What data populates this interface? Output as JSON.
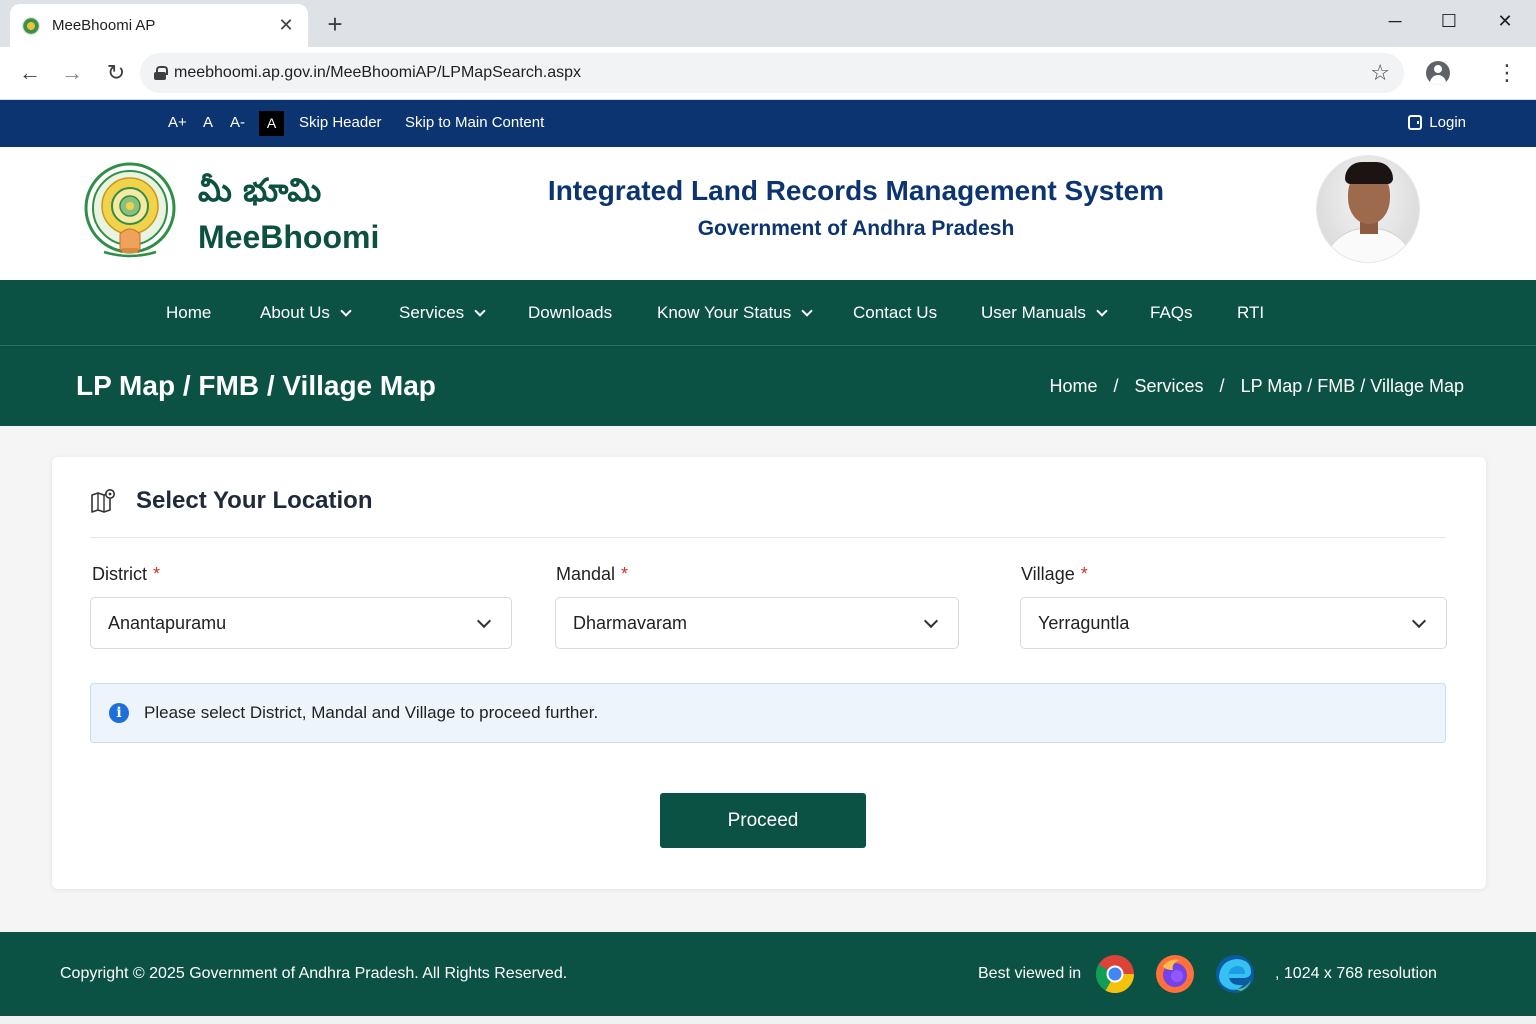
{
  "browser": {
    "tab_title": "MeeBhoomi AP",
    "url": "meebhoomi.ap.gov.in/MeeBhoomiAP/LPMapSearch.aspx"
  },
  "utility": {
    "font_increase": "A+",
    "font_normal": "A",
    "font_decrease": "A-",
    "contrast": "A",
    "skip_header": "Skip Header",
    "skip_main": "Skip to Main Content",
    "login": "Login"
  },
  "header": {
    "brand_telugu": "మీ భూమి",
    "brand_en": "MeeBhoomi",
    "title": "Integrated Land Records Management System",
    "subtitle": "Government of Andhra Pradesh"
  },
  "nav": {
    "items": [
      {
        "label": "Home"
      },
      {
        "label": "About Us"
      },
      {
        "label": "Services"
      },
      {
        "label": "Downloads"
      },
      {
        "label": "Know Your Status"
      },
      {
        "label": "Contact Us"
      },
      {
        "label": "User Manuals"
      },
      {
        "label": "FAQs"
      },
      {
        "label": "RTI"
      }
    ]
  },
  "page": {
    "title": "LP Map / FMB / Village Map",
    "breadcrumb": [
      "Home",
      "Services",
      "LP Map / FMB / Village Map"
    ],
    "breadcrumb_sep": "/"
  },
  "card": {
    "title": "Select Your Location",
    "required_mark": "*",
    "district_label": "District",
    "district_value": "Anantapuramu",
    "mandal_label": "Mandal",
    "mandal_value": "Dharmavaram",
    "village_label": "Village",
    "village_value": "Yerraguntla",
    "info_icon": "i",
    "info": "Please select District, Mandal and Village to proceed further.",
    "proceed": "Proceed"
  },
  "footer": {
    "copyright": "Copyright © 2025 Government of Andhra Pradesh. All Rights Reserved.",
    "best_viewed": "Best viewed in",
    "resolution": ",  1024 x 768 resolution"
  },
  "colors": {
    "utility_bar": "#0c3470",
    "primary_green": "#0b5244",
    "info_bg": "#edf4fc"
  }
}
